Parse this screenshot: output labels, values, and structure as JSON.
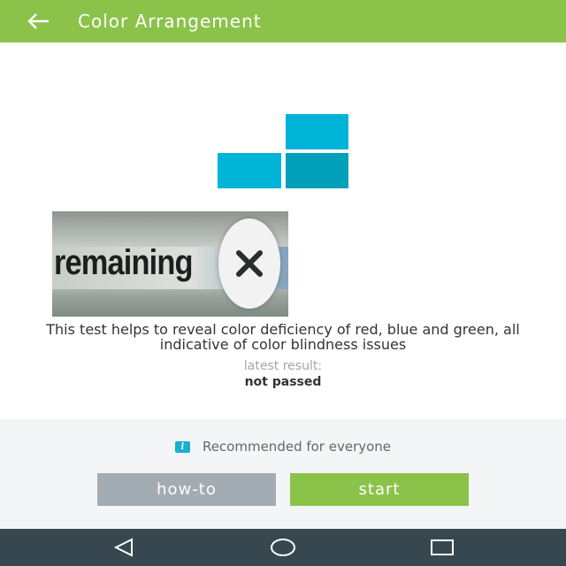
{
  "appbar": {
    "title": "Color Arrangement",
    "back_icon": "arrow-left-icon",
    "color": "#8bc34a"
  },
  "logo": {
    "icon": "color-squares-logo",
    "colors": [
      "#00b4d8",
      "#00a0bb"
    ]
  },
  "ad": {
    "text": "remaining",
    "close_icon": "close-icon"
  },
  "main": {
    "description": "This test helps to reveal color deficiency of red, blue and green, all indicative of color blindness issues",
    "latest_label": "latest result:",
    "latest_value": "not passed"
  },
  "footer": {
    "info_icon": "info-icon",
    "recommend_text": "Recommended for everyone",
    "howto_label": "how-to",
    "start_label": "start",
    "howto_color": "#a3acb2",
    "start_color": "#8bc34a"
  },
  "system_nav": {
    "items": [
      "back-icon",
      "home-icon",
      "recents-icon"
    ],
    "color": "#37474f"
  }
}
